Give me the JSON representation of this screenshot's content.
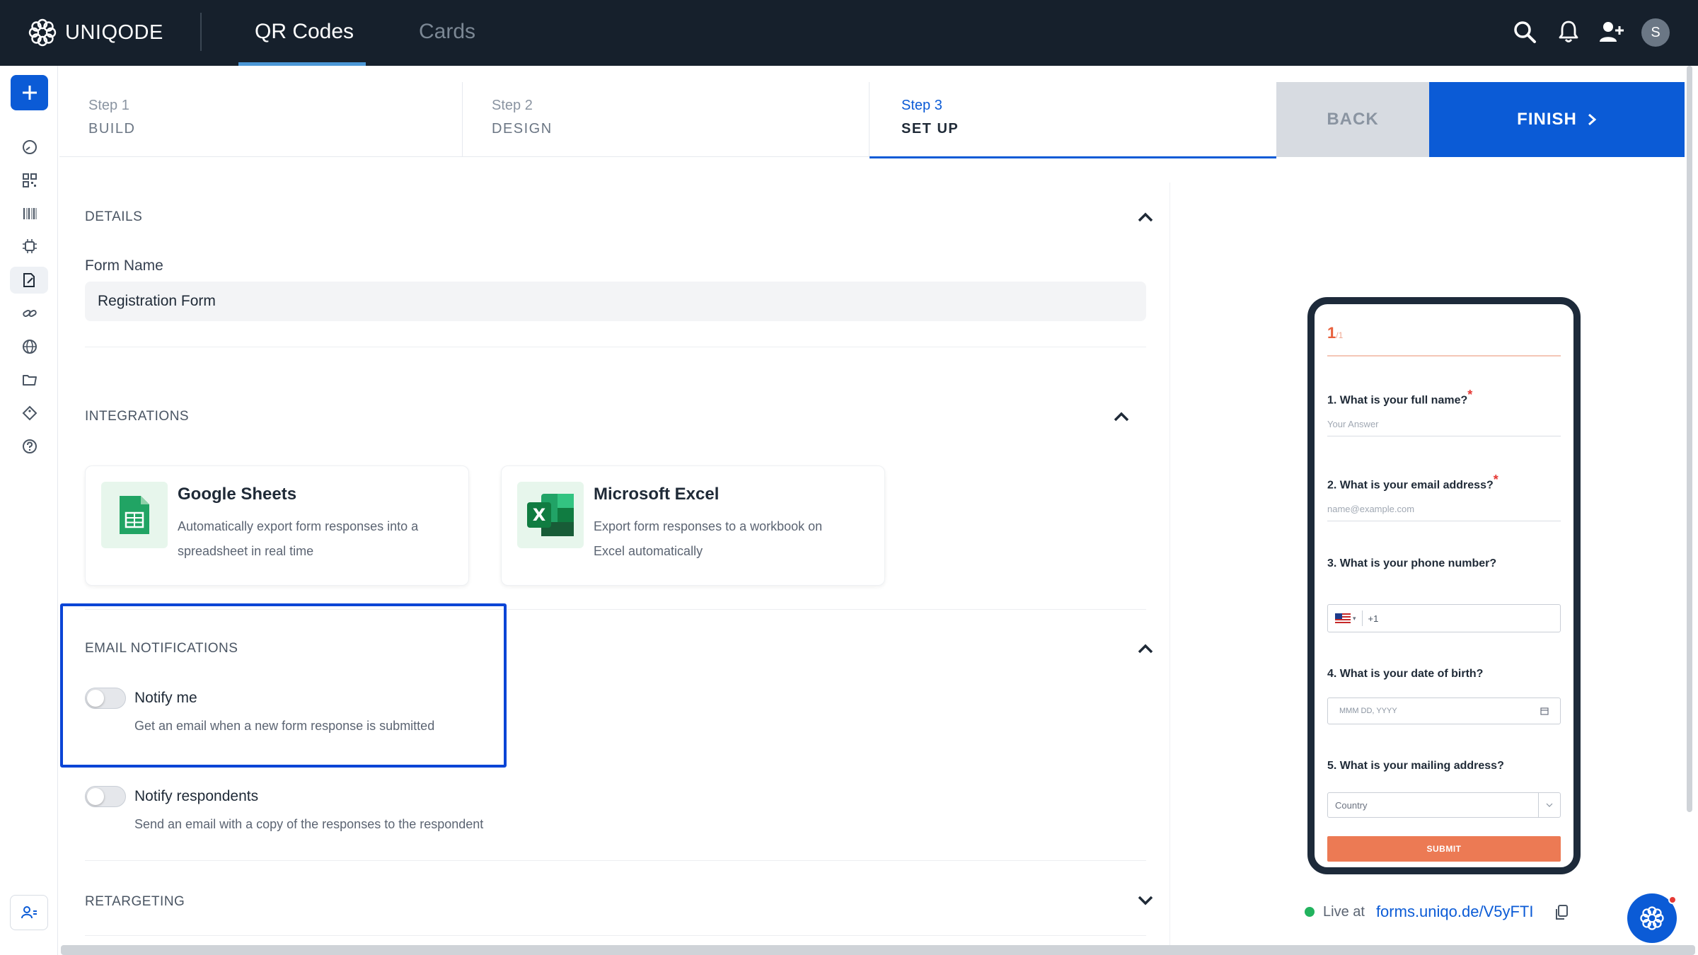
{
  "header": {
    "brand": "UNIQODE",
    "tabs": [
      {
        "label": "QR Codes",
        "active": true
      },
      {
        "label": "Cards",
        "active": false
      }
    ],
    "icons": [
      "search-icon",
      "bell-icon",
      "add-user-icon"
    ],
    "avatar_initial": "S"
  },
  "sidebar": {
    "add_icon": "plus-icon",
    "items": [
      {
        "icon": "dashboard-icon"
      },
      {
        "icon": "qr-code-icon"
      },
      {
        "icon": "barcode-icon"
      },
      {
        "icon": "ai-chip-icon"
      },
      {
        "icon": "form-icon",
        "active": true
      },
      {
        "icon": "link-icon"
      },
      {
        "icon": "globe-icon"
      },
      {
        "icon": "folder-icon"
      },
      {
        "icon": "tag-icon"
      },
      {
        "icon": "help-icon"
      }
    ],
    "bottom_icon": "users-icon"
  },
  "steps": [
    {
      "number": "Step 1",
      "name": "BUILD"
    },
    {
      "number": "Step 2",
      "name": "DESIGN"
    },
    {
      "number": "Step 3",
      "name": "SET UP",
      "active": true
    }
  ],
  "actions": {
    "back_label": "BACK",
    "finish_label": "FINISH"
  },
  "details": {
    "title": "DETAILS",
    "form_name_label": "Form Name",
    "form_name_value": "Registration Form"
  },
  "integrations": {
    "title": "INTEGRATIONS",
    "cards": [
      {
        "name": "Google Sheets",
        "desc_line1": "Automatically export form responses into a",
        "desc_line2": "spreadsheet in real time",
        "icon": "google-sheets-icon"
      },
      {
        "name": "Microsoft Excel",
        "desc_line1": "Export form responses to a workbook on",
        "desc_line2": "Excel automatically",
        "icon": "excel-icon"
      }
    ]
  },
  "email_notifications": {
    "title": "EMAIL NOTIFICATIONS",
    "notify_me": {
      "label": "Notify me",
      "desc": "Get an email when a new form response is submitted",
      "enabled": false
    },
    "notify_respondents": {
      "label": "Notify respondents",
      "desc": "Send an email with a copy of the responses to the respondent",
      "enabled": false
    }
  },
  "retargeting": {
    "title": "RETARGETING"
  },
  "preview": {
    "page_current": "1",
    "page_total": "/1",
    "questions": [
      {
        "label": "1. What is your full name?",
        "required": true,
        "placeholder": "Your Answer"
      },
      {
        "label": "2. What is your email address?",
        "required": true,
        "placeholder": "name@example.com"
      },
      {
        "label": "3. What is your phone number?",
        "required": false,
        "placeholder": "+1"
      },
      {
        "label": "4. What is your date of birth?",
        "required": false,
        "placeholder": "MMM DD, YYYY"
      },
      {
        "label": "5. What is your mailing address?",
        "required": false,
        "placeholder": "Country"
      }
    ],
    "submit_label": "SUBMIT",
    "required_mark": "*"
  },
  "live": {
    "prefix": "Live at",
    "url": "forms.uniqo.de/V5yFTI"
  },
  "colors": {
    "brand_blue": "#0b5bd6",
    "topbar": "#16202c",
    "accent_orange": "#ec7a54",
    "live_green": "#22b35e"
  }
}
